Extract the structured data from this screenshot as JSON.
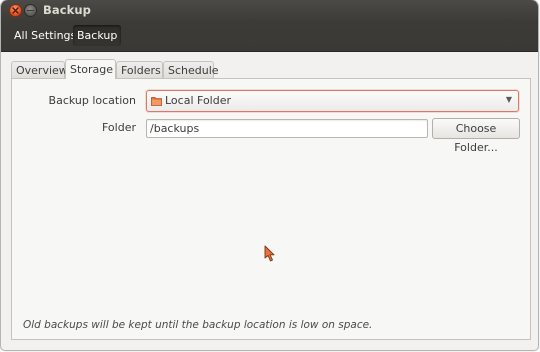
{
  "window": {
    "title": "Backup"
  },
  "toolbar": {
    "all_settings_label": "All Settings",
    "current_label": "Backup"
  },
  "tabs": [
    {
      "label": "Overview",
      "active": false
    },
    {
      "label": "Storage",
      "active": true
    },
    {
      "label": "Folders",
      "active": false
    },
    {
      "label": "Schedule",
      "active": false
    }
  ],
  "storage": {
    "backup_location_label": "Backup location",
    "backup_location_value": "Local Folder",
    "folder_label": "Folder",
    "folder_value": "/backups",
    "choose_folder_label": "Choose Folder...",
    "footer_note": "Old backups will be kept until the backup location is low on space."
  },
  "icons": {
    "close": "close-icon",
    "minimize": "minimize-icon",
    "location": "folder-icon",
    "dropdown": "chevron-down-icon",
    "pointer": "mouse-pointer-icon"
  },
  "colors": {
    "titlebar": "#3c3b37",
    "close_button": "#e7582b",
    "combo_focus_border": "#d9796b",
    "window_bg": "#f2f1f0",
    "panel_bg": "#f7f7f6",
    "folder_icon": "#e8723f"
  }
}
